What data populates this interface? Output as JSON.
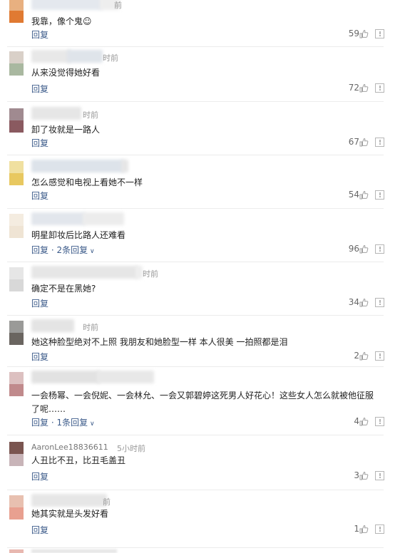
{
  "reply_label": "回复",
  "comments": [
    {
      "time": "前",
      "text": "我靠，像个鬼☺",
      "likes": "59",
      "replies": "",
      "avatar": [
        "#e8b080",
        "#e07a32"
      ]
    },
    {
      "time": "时前",
      "text": "从来没觉得她好看",
      "likes": "72",
      "replies": "",
      "avatar": [
        "#d9d0c8",
        "#a9b8a0"
      ]
    },
    {
      "time": "时前",
      "text": "卸了妆就是一路人",
      "likes": "67",
      "replies": "",
      "avatar": [
        "#a08a90",
        "#8a5a60"
      ]
    },
    {
      "time": "",
      "text": "怎么感觉和电视上看她不一样",
      "likes": "54",
      "replies": "",
      "avatar": [
        "#f0e0a0",
        "#e8c860"
      ]
    },
    {
      "time": "",
      "text": "明星卸妆后比路人还难看",
      "likes": "96",
      "replies": "2条回复",
      "avatar": [
        "#f4ece0",
        "#efe4d4"
      ]
    },
    {
      "time": "时前",
      "text": "确定不是在黑她?",
      "likes": "34",
      "replies": "",
      "avatar": [
        "#e6e6e6",
        "#d8d8d8"
      ]
    },
    {
      "time": "时前",
      "text": "她这种脸型绝对不上照 我朋友和她脸型一样 本人很美 一拍照都是泪",
      "likes": "2",
      "replies": "",
      "avatar": [
        "#9a9a98",
        "#6a6560"
      ]
    },
    {
      "time": "",
      "text": "一会杨幂、一会倪妮、一会林允、一会又郭碧婷这死男人好花心！这些女人怎么就被他征服了呢……",
      "likes": "4",
      "replies": "1条回复",
      "avatar": [
        "#dcc0c0",
        "#c08a8c"
      ]
    },
    {
      "username": "AaronLee18836611",
      "time": "5小时前",
      "text": "人丑比不丑，比丑毛盖丑",
      "likes": "3",
      "replies": "",
      "avatar": [
        "#7a5550",
        "#c8b4b8"
      ]
    },
    {
      "time": "前",
      "text": "她其实就是头发好看",
      "likes": "1",
      "replies": "",
      "avatar": [
        "#e8c0b0",
        "#e8a090"
      ]
    }
  ]
}
